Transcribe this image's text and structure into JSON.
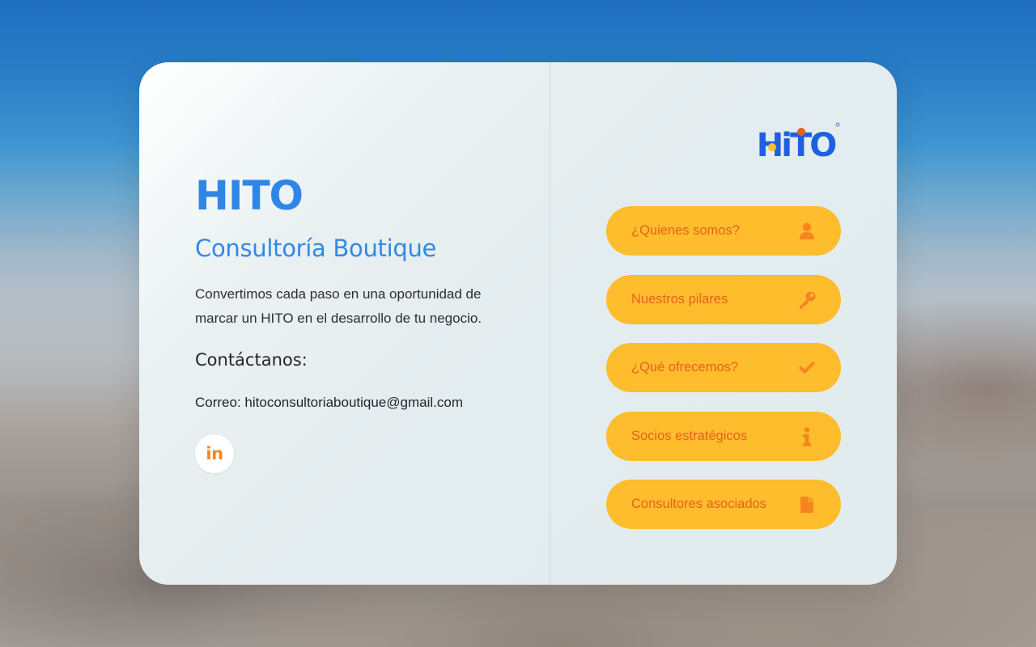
{
  "brand": {
    "title": "HITO",
    "subtitle": "Consultoría Boutique",
    "tagline": "Convertimos cada paso en una oportunidad de marcar un HITO en el desarrollo de tu negocio.",
    "logo_text": "HiTO"
  },
  "contact": {
    "heading": "Contáctanos:",
    "email_line": "Correo: hitoconsultoriaboutique@gmail.com",
    "linkedin_label": "in"
  },
  "menu": {
    "items": [
      {
        "label": "¿Quienes somos?",
        "icon": "user-icon"
      },
      {
        "label": "Nuestros pilares",
        "icon": "key-icon"
      },
      {
        "label": "¿Qué ofrecemos?",
        "icon": "check-icon"
      },
      {
        "label": "Socios estratégicos",
        "icon": "info-icon"
      },
      {
        "label": "Consultores asociados",
        "icon": "file-icon"
      }
    ]
  },
  "colors": {
    "brand_blue": "#2f86e6",
    "button_yellow": "#fdbd2c",
    "button_text_orange": "#e8611e",
    "icon_orange": "#f7851f"
  }
}
